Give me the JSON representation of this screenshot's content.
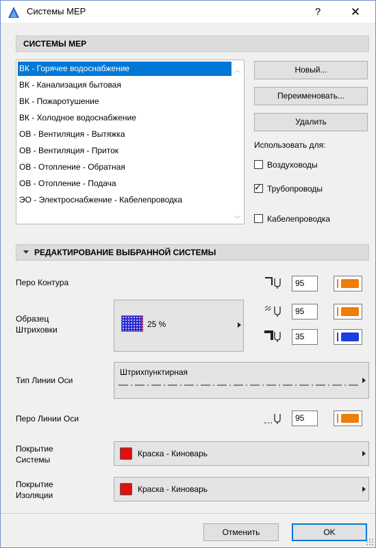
{
  "window": {
    "title": "Системы MEP",
    "help": "?",
    "close": "✕"
  },
  "systems_section": {
    "header": "СИСТЕМЫ MEP",
    "items": [
      "ВК - Горячее водоснабжение",
      "ВК - Канализация бытовая",
      "ВК - Пожаротушение",
      "ВК - Холодное водоснабжение",
      "ОВ - Вентиляция - Вытяжка",
      "ОВ - Вентиляция - Приток",
      "ОВ - Отопление - Обратная",
      "ОВ - Отопление - Подача",
      "ЭО - Электроснабжение - Кабелепроводка"
    ],
    "selected_index": 0,
    "buttons": {
      "new": "Новый...",
      "rename": "Переименовать...",
      "delete": "Удалить"
    },
    "use_for_label": "Использовать для:",
    "use_for": [
      {
        "label": "Воздуховоды",
        "checked": false
      },
      {
        "label": "Трубопроводы",
        "checked": true
      },
      {
        "label": "Кабелепроводка",
        "checked": false
      }
    ]
  },
  "edit_section": {
    "header": "РЕДАКТИРОВАНИЕ ВЫБРАННОЙ СИСТЕМЫ",
    "contour_pen": {
      "label": "Перо Контура",
      "value": "95",
      "color": "#f07c0a",
      "icon": "pen-contour-icon"
    },
    "hatch": {
      "label_line1": "Образец",
      "label_line2": "Штриховки",
      "pattern_percent": "25 %",
      "fg_pen": {
        "value": "95",
        "color": "#f07c0a",
        "icon": "pen-hatch-fg-icon"
      },
      "bg_pen": {
        "value": "35",
        "color": "#1a3ee0",
        "icon": "pen-hatch-bg-icon"
      }
    },
    "axis_line_type": {
      "label": "Тип Линии Оси",
      "value": "Штрихпунктирная"
    },
    "axis_pen": {
      "label": "Перо Линии Оси",
      "value": "95",
      "color": "#f07c0a",
      "icon": "pen-axis-icon"
    },
    "system_surface": {
      "label_line1": "Покрытие",
      "label_line2": "Системы",
      "value": "Краска - Киноварь",
      "color": "#e01010"
    },
    "insulation_surface": {
      "label_line1": "Покрытие",
      "label_line2": "Изоляции",
      "value": "Краска - Киноварь",
      "color": "#e01010"
    }
  },
  "footer": {
    "cancel": "Отменить",
    "ok": "OK"
  }
}
